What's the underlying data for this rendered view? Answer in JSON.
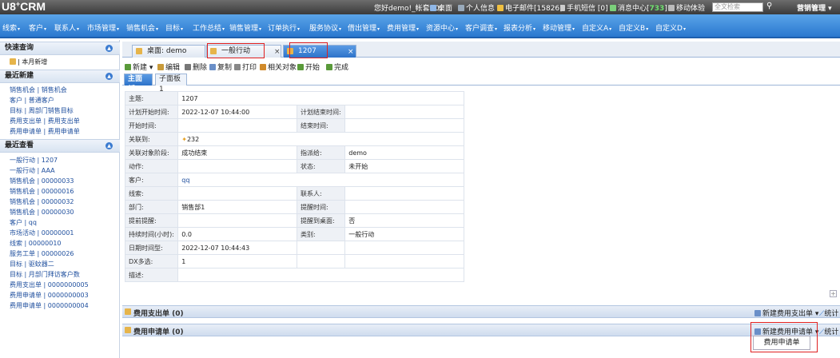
{
  "app": {
    "logo_a": "U8",
    "logo_b": "+",
    "logo_c": "CRM"
  },
  "topbar": {
    "greeting": "您好demo!_帐套:(0)",
    "desktop": "桌面",
    "personal": "个人信息",
    "email": "电子邮件[15826]",
    "sms": "手机短信 [0]",
    "msg_prefix": "消息中心[",
    "msg_count": "733",
    "msg_suffix": "]",
    "mobile": "移动体验",
    "search_placeholder": "全文检索",
    "admin": "营销管理"
  },
  "nav": [
    "线索",
    "客户",
    "联系人",
    "市场管理",
    "销售机会",
    "目标",
    "工作总结",
    "销售管理",
    "订单执行",
    "服务协议",
    "借出管理",
    "费用管理",
    "资源中心",
    "客户调查",
    "报表分析",
    "移动管理",
    "自定义A",
    "自定义B",
    "自定义D"
  ],
  "sidebar": {
    "quick_title": "快速查询",
    "quick_item": "本月新增",
    "recent_new_title": "最近新建",
    "recent_new": [
      "销售机会 | 销售机会",
      "客户 | 普通客户",
      "目标 | 周部门销售目标",
      "费用支出单 | 费用支出单",
      "费用申请单 | 费用申请单"
    ],
    "recent_view_title": "最近查看",
    "recent_view": [
      "一般行动 | 1207",
      "一般行动 | AAA",
      "销售机会 | 00000033",
      "销售机会 | 00000016",
      "销售机会 | 00000032",
      "销售机会 | 00000030",
      "客户 | qq",
      "市场活动 | 00000001",
      "线索 | 00000010",
      "服务工单 | 00000026",
      "目标 | 驱蚊器二",
      "目标 | 月部门拜访客户数",
      "费用支出单 | 0000000005",
      "费用申请单 | 0000000003",
      "费用申请单 | 0000000004"
    ]
  },
  "tabs": {
    "t1": "桌面: demo",
    "t2": "一般行动",
    "t3": "1207",
    "close": "×"
  },
  "toolbar": {
    "new": "新建",
    "edit": "编辑",
    "delete": "删除",
    "copy": "复制",
    "print": "打印",
    "related": "相关对象",
    "start": "开始",
    "finish": "完成"
  },
  "subtabs": {
    "main": "主面板",
    "sub1": "子面板 1"
  },
  "form": {
    "subject_l": "主题:",
    "subject_v": "1207",
    "plan_start_l": "计划开始时间:",
    "plan_start_v": "2022-12-07 10:44:00",
    "plan_end_l": "计划结束时间:",
    "plan_end_v": "",
    "start_l": "开始时间:",
    "start_v": "",
    "end_l": "结束时间:",
    "end_v": "",
    "related_l": "关联到:",
    "related_v": "232",
    "stage_l": "关联对象阶段:",
    "stage_v": "成功结束",
    "assign_l": "指派给:",
    "assign_v": "demo",
    "action_l": "动作:",
    "action_v": "",
    "status_l": "状态:",
    "status_v": "未开始",
    "customer_l": "客户:",
    "customer_v": "qq",
    "lead_l": "线索:",
    "lead_v": "",
    "contact_l": "联系人:",
    "contact_v": "",
    "dept_l": "部门:",
    "dept_v": "销售部1",
    "remind_time_l": "提醒时间:",
    "remind_time_v": "",
    "pre_remind_l": "提前提醒:",
    "pre_remind_v": "",
    "remind_desk_l": "提醒到桌面:",
    "remind_desk_v": "否",
    "duration_l": "持续时间(小时):",
    "duration_v": "0.0",
    "category_l": "类别:",
    "category_v": "一般行动",
    "datetime_l": "日期时间型:",
    "datetime_v": "2022-12-07 10:44:43",
    "dx_l": "DX多选:",
    "dx_v": "1",
    "desc_l": "描述:",
    "desc_v": ""
  },
  "sections": {
    "expense_out": "费用支出单 (0)",
    "new_expense_out": "新建费用支出单",
    "stats": "统计",
    "expense_apply": "费用申请单 (0)",
    "new_expense_apply": "新建费用申请单",
    "dropdown_item": "费用申请单"
  }
}
